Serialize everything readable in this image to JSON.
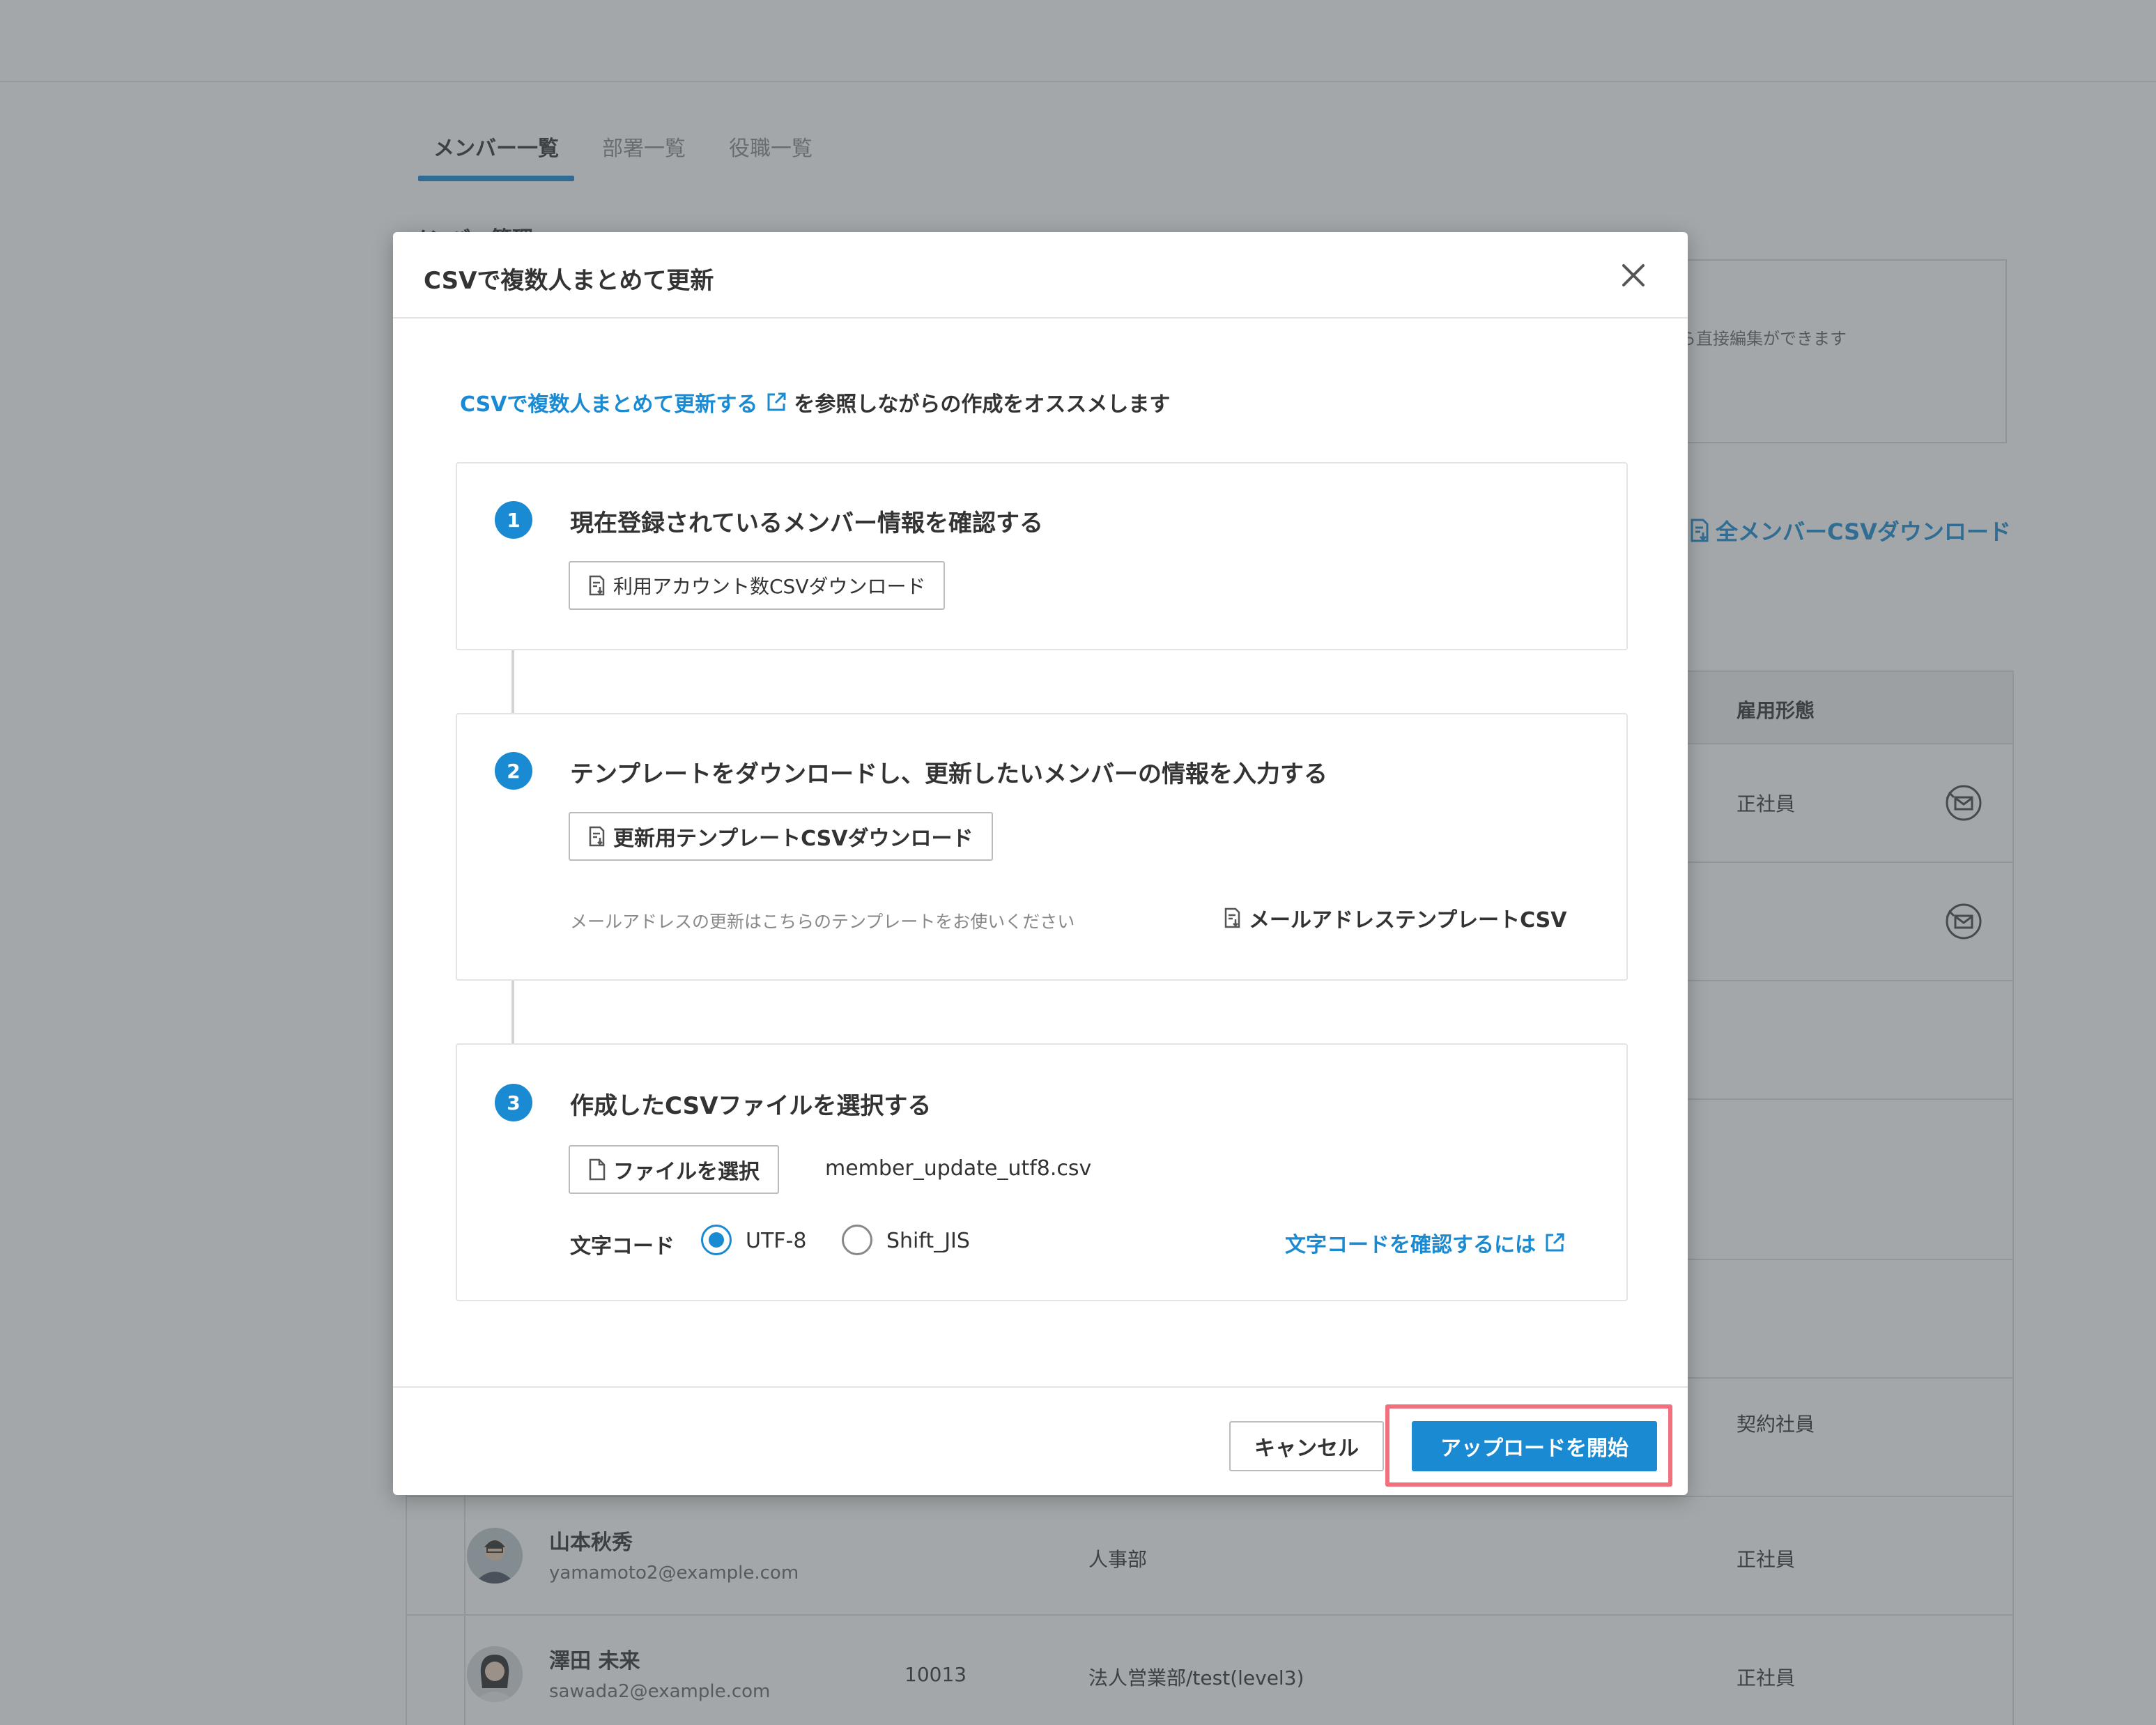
{
  "background": {
    "tabs": [
      {
        "label": "メンバー一覧",
        "active": true
      },
      {
        "label": "部署一覧",
        "active": false
      },
      {
        "label": "役職一覧",
        "active": false
      }
    ],
    "section_title": "メンバー管理",
    "info_text": "ら直接編集ができます",
    "download_all": "全メンバーCSVダウンロード",
    "table": {
      "header_employment": "雇用形態",
      "rows": [
        {
          "employment": "正社員",
          "has_mail_icon": true
        },
        {
          "employment": "",
          "has_mail_icon": true
        },
        {
          "employment": "契約社員",
          "has_mail_icon": false
        },
        {
          "name": "山本秋秀",
          "email": "yamamoto2@example.com",
          "number": "",
          "dept": "人事部",
          "employment": "正社員"
        },
        {
          "name": "澤田 未来",
          "email": "sawada2@example.com",
          "number": "10013",
          "dept": "法人営業部/test(level3)",
          "employment": "正社員"
        }
      ]
    }
  },
  "modal": {
    "title": "CSVで複数人まとめて更新",
    "ref_link": "CSVで複数人まとめて更新する",
    "ref_suffix": "を参照しながらの作成をオススメします",
    "steps": [
      {
        "number": "1",
        "title": "現在登録されているメンバー情報を確認する",
        "button": "利用アカウント数CSVダウンロード"
      },
      {
        "number": "2",
        "title": "テンプレートをダウンロードし、更新したいメンバーの情報を入力する",
        "button": "更新用テンプレートCSVダウンロード",
        "note": "メールアドレスの更新はこちらのテンプレートをお使いください",
        "link": "メールアドレステンプレートCSV"
      },
      {
        "number": "3",
        "title": "作成したCSVファイルを選択する",
        "button": "ファイルを選択",
        "file_name": "member_update_utf8.csv",
        "encoding_label": "文字コード",
        "encoding_options": [
          {
            "label": "UTF-8",
            "checked": true
          },
          {
            "label": "Shift_JIS",
            "checked": false
          }
        ],
        "encoding_link": "文字コードを確認するには"
      }
    ],
    "footer": {
      "cancel": "キャンセル",
      "upload": "アップロードを開始"
    }
  },
  "colors": {
    "accent": "#1a8ad2",
    "highlight": "#f2707d"
  }
}
